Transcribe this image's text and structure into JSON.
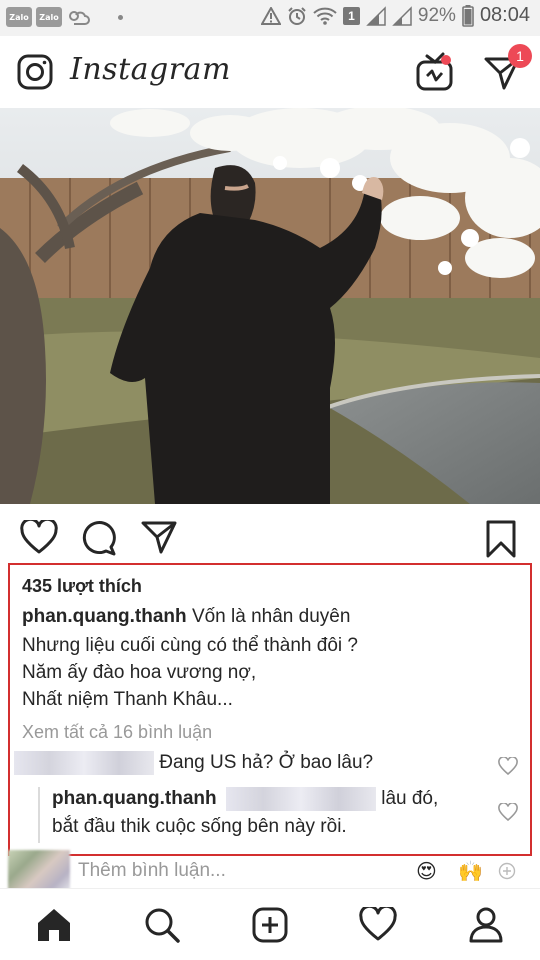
{
  "status_bar": {
    "left_apps": [
      "Zalo",
      "Zalo"
    ],
    "sim_slot": "1",
    "battery": "92%",
    "time": "08:04"
  },
  "header": {
    "logo": "Instagram",
    "notification_count": "1"
  },
  "post": {
    "likes": "435 lượt thích",
    "username": "phan.quang.thanh",
    "caption_lines": [
      "Vốn là nhân duyên",
      "Nhưng liệu cuối cùng có thể thành đôi ?",
      "Năm ấy đào hoa vương nợ,",
      "Nhất niệm Thanh Khâu..."
    ],
    "view_all_comments": "Xem tất cả 16 bình luận",
    "comments": [
      {
        "text": "Đang US hả? Ở bao lâu?"
      },
      {
        "username": "phan.quang.thanh",
        "text_line1": "lâu đó,",
        "text_line2": "bắt đầu thik cuộc sống bên này rồi."
      }
    ]
  },
  "add_comment": {
    "placeholder": "Thêm bình luận..."
  }
}
